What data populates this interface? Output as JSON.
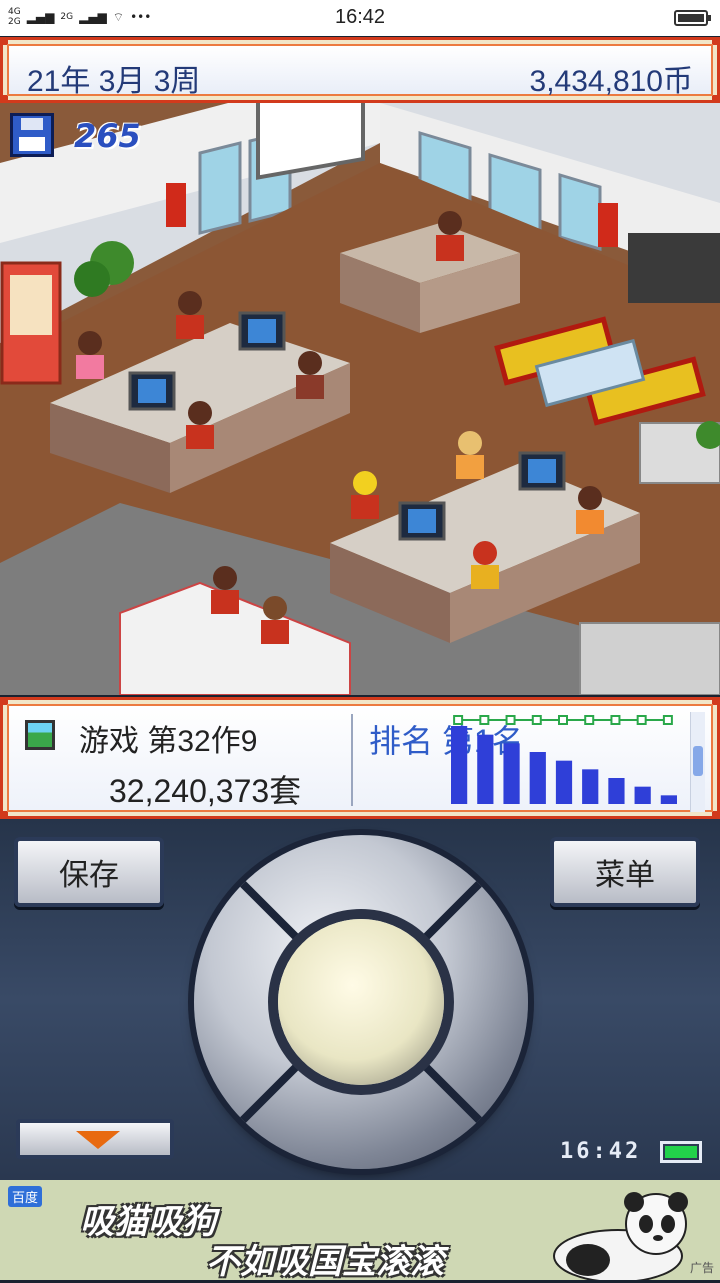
{
  "status_bar": {
    "network_top": "4G",
    "network_bottom": "2G",
    "network_2": "2G",
    "dots": "•••",
    "time": "16:42"
  },
  "top_bar": {
    "date": "21年 3月 3周",
    "money": "3,434,810币"
  },
  "scene": {
    "research_points": "265",
    "icon": "floppy-disk-icon"
  },
  "info_panel": {
    "game_title": "游戏 第32作9",
    "sales": "32,240,373套",
    "rank_label": "排名 第1名",
    "rank_bars": [
      9,
      8,
      7,
      6,
      5,
      4,
      3,
      2,
      1
    ],
    "bar_color": "#2f3fd8"
  },
  "controls": {
    "save_label": "保存",
    "menu_label": "菜单",
    "clock": "16:42",
    "battery_color": "#22d24a"
  },
  "ad": {
    "logo": "百度",
    "line1": "吸猫吸狗",
    "line2": "不如吸国宝滚滚",
    "tag": "广告"
  },
  "colors": {
    "frame": "#d23a1c",
    "accent_blue": "#2f5cc8"
  }
}
